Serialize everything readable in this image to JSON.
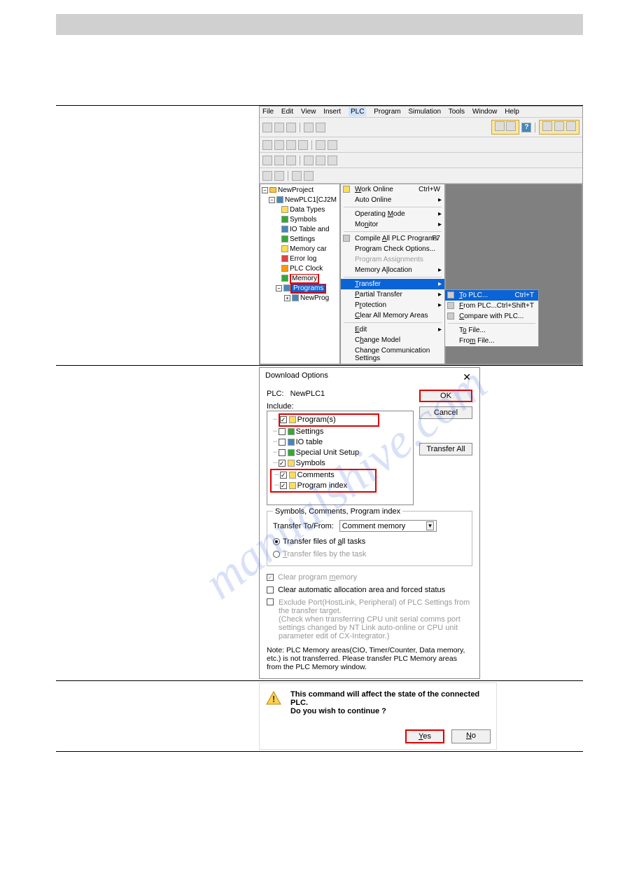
{
  "watermark": "manualshive.com",
  "section1": {
    "menubar": [
      "File",
      "Edit",
      "View",
      "Insert",
      "PLC",
      "Program",
      "Simulation",
      "Tools",
      "Window",
      "Help"
    ],
    "menubar_highlight_index": 4,
    "tree": {
      "root": "NewProject",
      "plc": "NewPLC1[CJ2M",
      "nodes": [
        {
          "label": "Data Types",
          "icon": "yellow"
        },
        {
          "label": "Symbols",
          "icon": "green"
        },
        {
          "label": "IO Table and",
          "icon": "blue"
        },
        {
          "label": "Settings",
          "icon": "green"
        },
        {
          "label": "Memory car",
          "icon": "yellow"
        },
        {
          "label": "Error log",
          "icon": "red"
        },
        {
          "label": "PLC Clock",
          "icon": "orange"
        },
        {
          "label": "Memory",
          "icon": "green",
          "underline": true
        },
        {
          "label": "Programs",
          "icon": "blue",
          "highlight": true
        },
        {
          "label": "NewProg",
          "icon": "blue",
          "sub": true
        }
      ]
    },
    "plc_menu": [
      {
        "label": "Work Online",
        "shortcut": "Ctrl+W",
        "icon": true
      },
      {
        "label": "Auto Online",
        "arrow": true
      },
      {
        "sep": true
      },
      {
        "label": "Operating Mode",
        "arrow": true
      },
      {
        "label": "Monitor",
        "arrow": true
      },
      {
        "sep": true
      },
      {
        "label": "Compile All PLC Programs",
        "shortcut": "F7",
        "icon": true
      },
      {
        "label": "Program Check Options..."
      },
      {
        "label": "Program Assignments",
        "grayed": true
      },
      {
        "label": "Memory Allocation",
        "arrow": true
      },
      {
        "sep": true
      },
      {
        "label": "Transfer",
        "arrow": true,
        "highlight": true
      },
      {
        "label": "Partial Transfer",
        "arrow": true
      },
      {
        "label": "Protection",
        "arrow": true
      },
      {
        "label": "Clear All Memory Areas"
      },
      {
        "sep": true
      },
      {
        "label": "Edit",
        "arrow": true
      },
      {
        "label": "Change Model"
      },
      {
        "label": "Change Communication Settings"
      }
    ],
    "transfer_submenu": [
      {
        "label": "To PLC...",
        "shortcut": "Ctrl+T",
        "highlight": true,
        "icon": true
      },
      {
        "label": "From PLC...",
        "shortcut": "Ctrl+Shift+T",
        "icon": true
      },
      {
        "label": "Compare with PLC...",
        "icon": true
      },
      {
        "sep": true
      },
      {
        "label": "To File..."
      },
      {
        "label": "From File..."
      }
    ]
  },
  "section2": {
    "title": "Download Options",
    "plc_label": "PLC:",
    "plc_name": "NewPLC1",
    "include_label": "Include:",
    "buttons": {
      "ok": "OK",
      "cancel": "Cancel",
      "transfer_all": "Transfer All"
    },
    "tree": [
      {
        "label": "Program(s)",
        "checked": true,
        "redbox": true,
        "icon": "yellow"
      },
      {
        "label": "Settings",
        "checked": false,
        "icon": "green"
      },
      {
        "label": "IO table",
        "checked": false,
        "icon": "blue"
      },
      {
        "label": "Special Unit Setup",
        "checked": false,
        "icon": "green"
      },
      {
        "label": "Symbols",
        "checked": true,
        "icon": "yellow"
      },
      {
        "label": "Comments",
        "checked": true,
        "redbox_group": "start",
        "icon": "yellow"
      },
      {
        "label": "Program index",
        "checked": true,
        "redbox_group": "end",
        "icon": "yellow"
      }
    ],
    "fieldset_title": "Symbols, Comments, Program index",
    "transfer_to_from": "Transfer To/From:",
    "dropdown_value": "Comment memory",
    "radio1": "Transfer files of all tasks",
    "radio2": "Transfer files by the task",
    "chk1": "Clear program memory",
    "chk2": "Clear automatic allocation area and forced status",
    "chk3_line1": "Exclude Port(HostLink, Peripheral) of PLC Settings from the transfer target.",
    "chk3_line2": "(Check when transferring CPU unit serial comms port settings changed by NT Link auto-online or CPU unit parameter edit of CX-Integrator.)",
    "note": "Note: PLC Memory areas(CIO, Timer/Counter, Data memory, etc.) is not transferred. Please transfer PLC Memory areas from the PLC Memory window."
  },
  "section3": {
    "line1": "This command will affect the state of the connected PLC.",
    "line2": "Do you wish to continue ?",
    "yes": "Yes",
    "no": "No"
  }
}
